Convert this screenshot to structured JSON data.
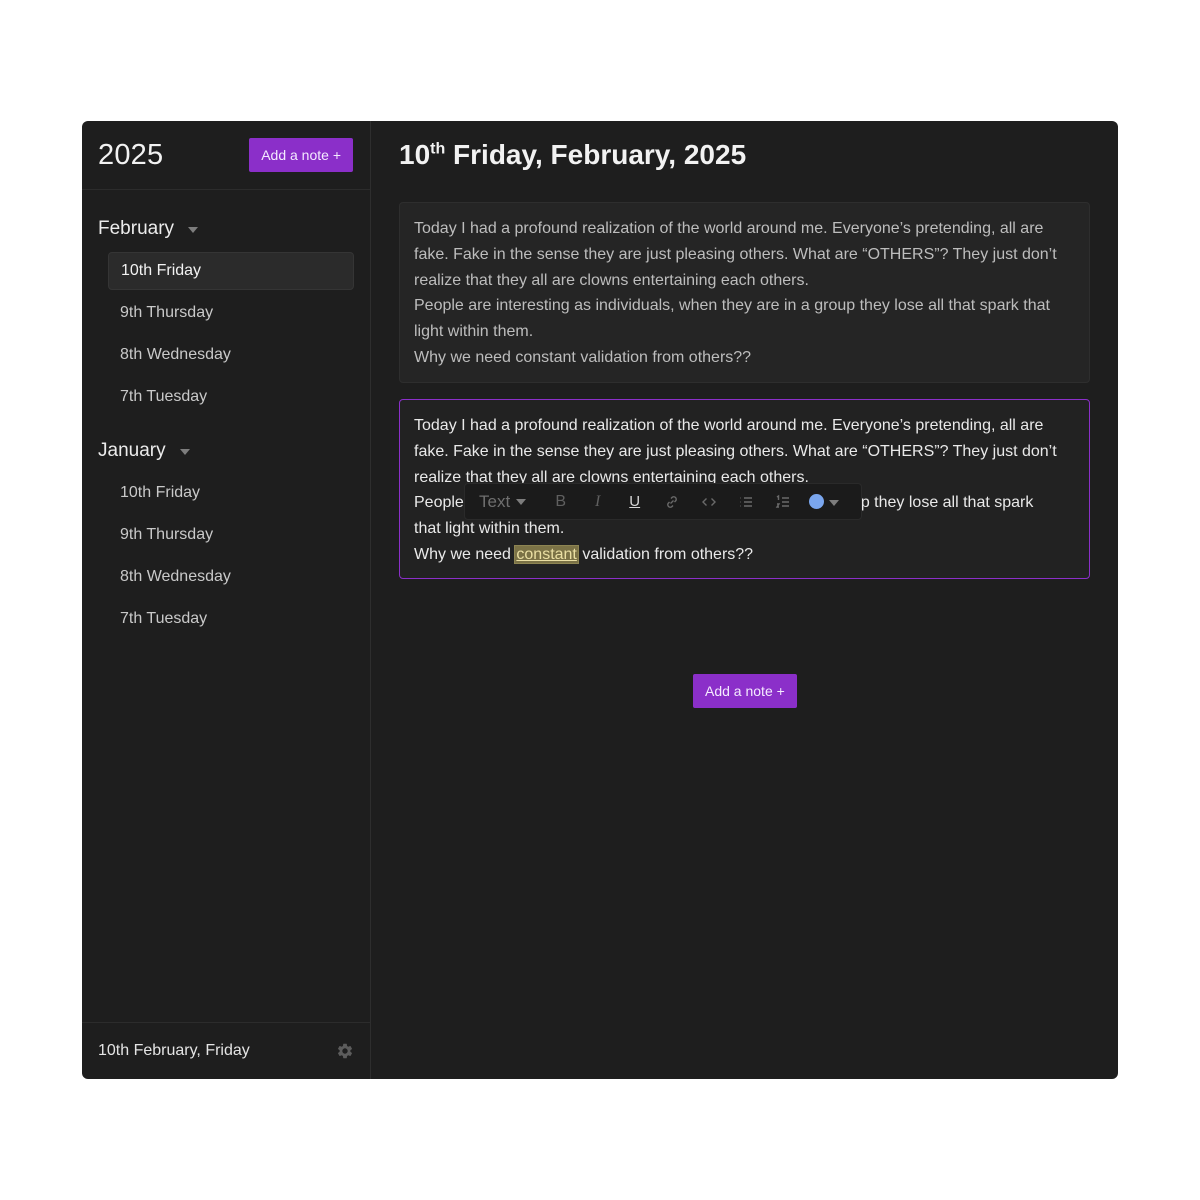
{
  "sidebar": {
    "year": "2025",
    "add_note_label": "Add a note +",
    "months": [
      {
        "name": "February",
        "days": [
          "10th Friday",
          "9th Thursday",
          "8th Wednesday",
          "7th Tuesday"
        ]
      },
      {
        "name": "January",
        "days": [
          "10th Friday",
          "9th Thursday",
          "8th Wednesday",
          "7th Tuesday"
        ]
      }
    ],
    "active_day": "10th Friday",
    "footer_date": "10th February, Friday",
    "settings_icon": "gear-icon"
  },
  "main": {
    "title_day": "10",
    "title_suffix": "th",
    "title_rest": " Friday, February, 2025",
    "note1": {
      "lines": [
        "Today I had a profound realization of the world around me. Everyone’s pretending, all are fake. Fake in the sense they are just pleasing others. What are “OTHERS”? They just don’t realize that they all are clowns entertaining each others.",
        "People are interesting as individuals, when they are in a group they lose all that spark that light within them.",
        "Why we need constant validation from others??"
      ]
    },
    "note2": {
      "line1": "Today I had a profound realization of the world around me. Everyone’s pretending, all are fake. Fake in the sense they are just pleasing others. What are “OTHERS”? They just don’t realize that they all are clowns entertaining each others.",
      "line2_start": "People",
      "line2_end": "p they lose all that spark",
      "line2_cont": "that light within them.",
      "line3_before": "Why we need ",
      "line3_highlight": "constant",
      "line3_after": " validation from others??"
    },
    "toolbar": {
      "text_style": "Text",
      "bold": "B",
      "italic": "I",
      "underline": "U",
      "highlight_color": "#7aa6ee"
    },
    "add_note_label": "Add a note +"
  },
  "colors": {
    "accent": "#8b2fc9",
    "background": "#1e1e1e",
    "highlight": "#7b7246"
  }
}
